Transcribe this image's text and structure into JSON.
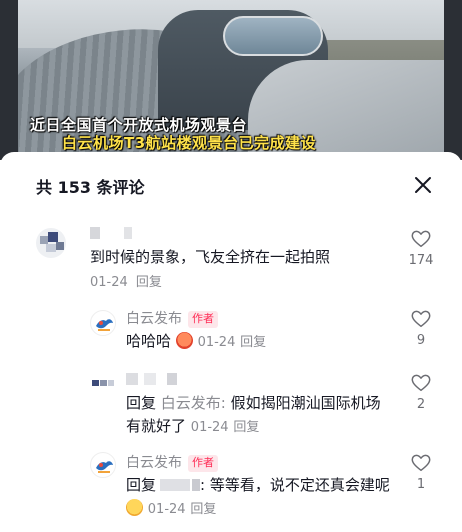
{
  "video": {
    "caption_line1": "近日全国首个开放式机场观景台",
    "caption_line2": "白云机场T3航站楼观景台已完成建设"
  },
  "comments_header": {
    "title": "共 153 条评论"
  },
  "comments": [
    {
      "text": "到时候的景象，飞友全挤在一起拍照",
      "date": "01-24",
      "reply_label": "回复",
      "likes": "174"
    },
    {
      "author": "白云发布",
      "author_tag": "作者",
      "text": "哈哈哈",
      "date": "01-24",
      "reply_label": "回复",
      "likes": "9"
    },
    {
      "reply_prefix": "回复",
      "reply_to": "白云发布:",
      "text": " 假如揭阳潮汕国际机场有就好了",
      "date": "01-24",
      "reply_label": "回复",
      "likes": "2"
    },
    {
      "author": "白云发布",
      "author_tag": "作者",
      "reply_prefix": "回复",
      "text": ": 等等看，说不定还真会建呢",
      "date": "01-24",
      "reply_label": "回复",
      "likes": "1"
    }
  ],
  "colors": {
    "accent_red": "#fe2c55",
    "caption_yellow": "#ffe24a",
    "muted_text": "#8a8b91"
  },
  "icons": {
    "close": "close-icon",
    "like": "heart-outline-icon"
  }
}
